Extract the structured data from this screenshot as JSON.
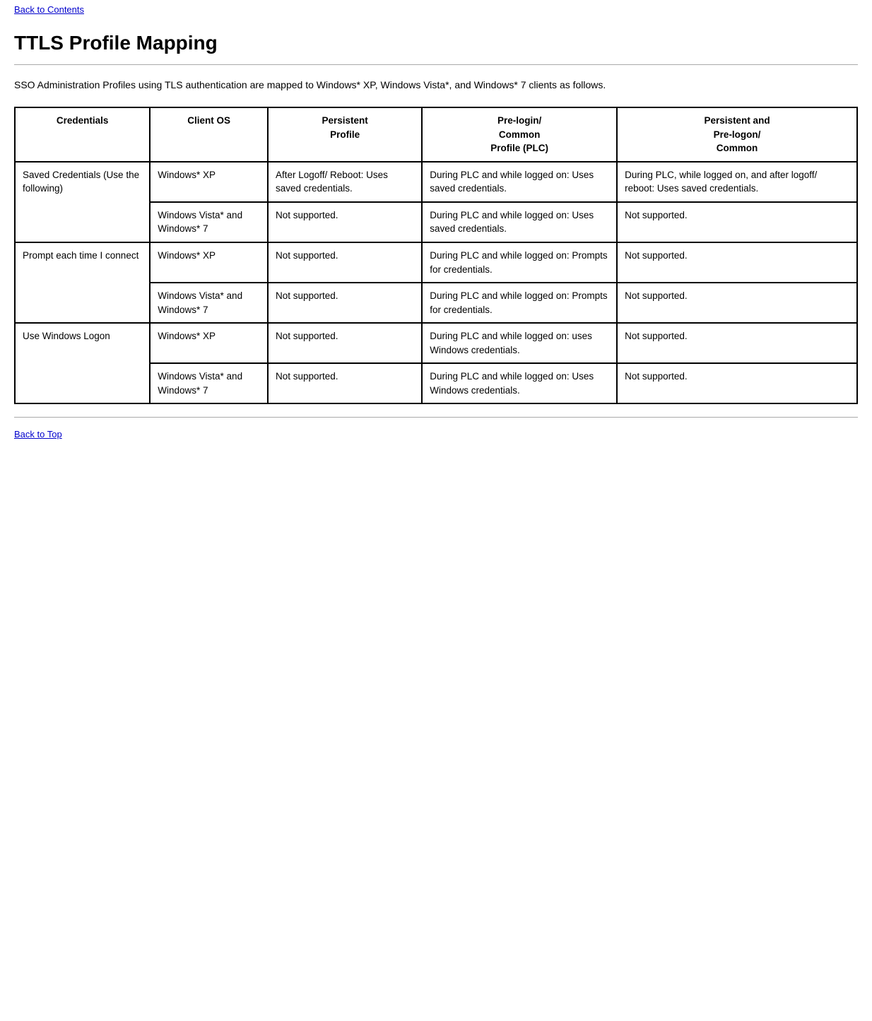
{
  "nav": {
    "back_to_contents": "Back to Contents",
    "back_to_top": "Back to Top"
  },
  "page": {
    "title": "TTLS Profile Mapping",
    "intro": "SSO Administration Profiles using TLS authentication are mapped to Windows* XP, Windows Vista*, and Windows* 7 clients as follows."
  },
  "table": {
    "headers": [
      "Credentials",
      "Client OS",
      "Persistent Profile",
      "Pre-login/\nCommon Profile (PLC)",
      "Persistent and Pre-logon/\nCommon"
    ],
    "rows": [
      {
        "credentials": "Saved Credentials (Use the following)",
        "client_os": "Windows* XP",
        "persistent_profile": "After Logoff/ Reboot: Uses saved credentials.",
        "pre_login": "During PLC and while logged on: Uses saved credentials.",
        "persistent_and_pre": "During PLC, while logged on, and after logoff/ reboot: Uses saved credentials."
      },
      {
        "credentials": "",
        "client_os": "Windows Vista* and Windows* 7",
        "persistent_profile": "Not supported.",
        "pre_login": "During PLC and while logged on: Uses saved credentials.",
        "persistent_and_pre": "Not supported."
      },
      {
        "credentials": "Prompt each time I connect",
        "client_os": "Windows* XP",
        "persistent_profile": "Not supported.",
        "pre_login": "During PLC and while logged on: Prompts for credentials.",
        "persistent_and_pre": "Not supported."
      },
      {
        "credentials": "",
        "client_os": "Windows Vista* and Windows* 7",
        "persistent_profile": "Not supported.",
        "pre_login": "During PLC and while logged on: Prompts for credentials.",
        "persistent_and_pre": "Not supported."
      },
      {
        "credentials": "Use Windows Logon",
        "client_os": "Windows* XP",
        "persistent_profile": "Not supported.",
        "pre_login": "During PLC and while logged on: uses Windows credentials.",
        "persistent_and_pre": "Not supported."
      },
      {
        "credentials": "",
        "client_os": "Windows Vista* and Windows* 7",
        "persistent_profile": "Not supported.",
        "pre_login": "During PLC and while logged on: Uses Windows credentials.",
        "persistent_and_pre": "Not supported."
      }
    ]
  }
}
